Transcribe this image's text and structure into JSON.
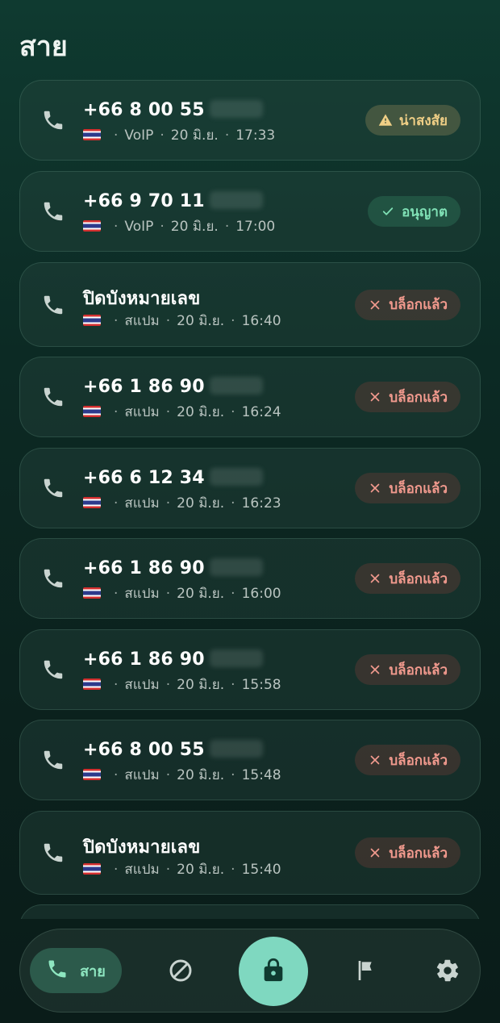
{
  "screen": {
    "title": "สาย"
  },
  "calls": [
    {
      "number": "+66 8 00 55",
      "type": "VoIP",
      "date": "20 มิ.ย.",
      "time": "17:33",
      "status": "warn",
      "status_label": "น่าสงสัย"
    },
    {
      "number": "+66 9 70 11",
      "type": "VoIP",
      "date": "20 มิ.ย.",
      "time": "17:00",
      "status": "ok",
      "status_label": "อนุญาต"
    },
    {
      "number": "ปิดบังหมายเลข",
      "type": "สแปม",
      "date": "20 มิ.ย.",
      "time": "16:40",
      "status": "block",
      "status_label": "บล็อกแล้ว"
    },
    {
      "number": "+66 1 86 90",
      "type": "สแปม",
      "date": "20 มิ.ย.",
      "time": "16:24",
      "status": "block",
      "status_label": "บล็อกแล้ว"
    },
    {
      "number": "+66 6 12 34",
      "type": "สแปม",
      "date": "20 มิ.ย.",
      "time": "16:23",
      "status": "block",
      "status_label": "บล็อกแล้ว"
    },
    {
      "number": "+66 1 86 90",
      "type": "สแปม",
      "date": "20 มิ.ย.",
      "time": "16:00",
      "status": "block",
      "status_label": "บล็อกแล้ว"
    },
    {
      "number": "+66 1 86 90",
      "type": "สแปม",
      "date": "20 มิ.ย.",
      "time": "15:58",
      "status": "block",
      "status_label": "บล็อกแล้ว"
    },
    {
      "number": "+66 8 00 55",
      "type": "สแปม",
      "date": "20 มิ.ย.",
      "time": "15:48",
      "status": "block",
      "status_label": "บล็อกแล้ว"
    },
    {
      "number": "ปิดบังหมายเลข",
      "type": "สแปม",
      "date": "20 มิ.ย.",
      "time": "15:40",
      "status": "block",
      "status_label": "บล็อกแล้ว"
    }
  ],
  "nav": {
    "calls_label": "สาย",
    "items": [
      "phone-icon",
      "block-icon",
      "lock-icon",
      "flag-icon",
      "settings-icon"
    ]
  },
  "colors": {
    "accent": "#7fd8c0",
    "warn": "#f0cf86",
    "ok": "#7fe0b5",
    "block": "#f29a8e"
  }
}
